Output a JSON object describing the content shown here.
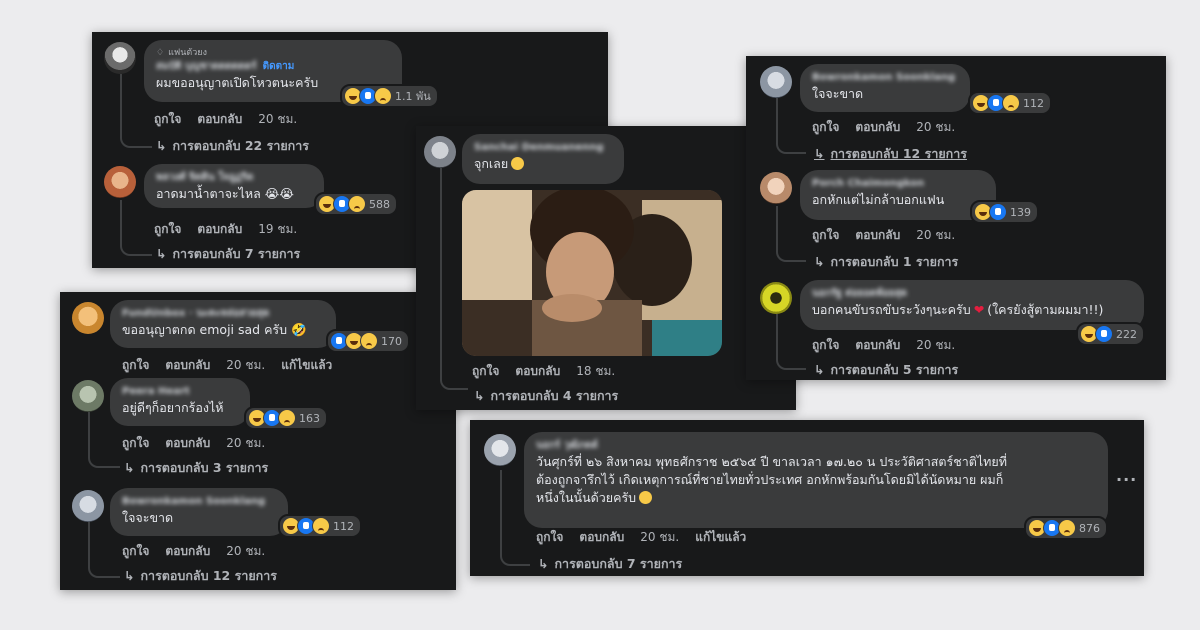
{
  "colors": {
    "page_bg": "#ececee",
    "panel_bg": "#18191a",
    "bubble_bg": "#3a3b3c",
    "link": "#4599ff",
    "heart": "#e41e3f"
  },
  "panels": [
    {
      "comments": [
        {
          "name": "สมบัติ บุญชาดดดดดดร์",
          "badge": "แฟนตัวยง",
          "follow": "ติดตาม",
          "text": "ผมขออนุญาตเปิดโหวตนะครับ",
          "reactions": [
            "haha",
            "like",
            "sad"
          ],
          "count": "1.1 พัน",
          "actions": [
            "ถูกใจ",
            "ตอบกลับ",
            "20 ชม."
          ],
          "replies": "การตอบกลับ 22 รายการ"
        },
        {
          "name": "พลวงศ์ จิดดิน ใจอูฏริด",
          "text": "อาดมาน้ำตาจะไหล 😭😭",
          "reactions": [
            "haha",
            "like",
            "sad"
          ],
          "count": "588",
          "actions": [
            "ถูกใจ",
            "ตอบกลับ",
            "19 ชม."
          ],
          "replies": "การตอบกลับ 7 รายการ"
        }
      ]
    },
    {
      "comments": [
        {
          "name": "FundUnbox · นะคะหล่อสวยสุด",
          "text": "ขออนุญาตกด emoji sad ครับ 🤣",
          "reactions": [
            "like",
            "haha",
            "sad"
          ],
          "count": "170",
          "actions": [
            "ถูกใจ",
            "ตอบกลับ",
            "20 ชม.",
            "แก้ไขแล้ว"
          ]
        },
        {
          "name": "Peera Heart",
          "text": "อยู่ดีๆก็อยากร้องไห้",
          "reactions": [
            "haha",
            "like",
            "sad"
          ],
          "count": "163",
          "actions": [
            "ถูกใจ",
            "ตอบกลับ",
            "20 ชม."
          ],
          "replies": "การตอบกลับ 3 รายการ"
        },
        {
          "name": "Bowronkamon Soonklang",
          "text": "ใจจะขาด",
          "reactions": [
            "haha",
            "like",
            "sad"
          ],
          "count": "112",
          "actions": [
            "ถูกใจ",
            "ตอบกลับ",
            "20 ชม."
          ],
          "replies": "การตอบกลับ 12 รายการ"
        }
      ]
    },
    {
      "comments": [
        {
          "name": "Sanchai Denmuanenng",
          "text": "จุกเลย",
          "actions": [
            "ถูกใจ",
            "ตอบกลับ",
            "18 ชม."
          ],
          "replies": "การตอบกลับ 4 รายการ"
        }
      ]
    },
    {
      "comments": [
        {
          "name": "Bowronkamon Soonklang",
          "text": "ใจจะขาด",
          "reactions": [
            "haha",
            "like",
            "sad"
          ],
          "count": "112",
          "actions": [
            "ถูกใจ",
            "ตอบกลับ",
            "20 ชม."
          ],
          "replies": "การตอบกลับ 12 รายการ"
        },
        {
          "name": "Porch Chaimongkon",
          "text": "อกหักแต่ไม่กล้าบอกแฟน",
          "reactions": [
            "haha",
            "like"
          ],
          "count": "139",
          "actions": [
            "ถูกใจ",
            "ตอบกลับ",
            "20 ชม."
          ],
          "replies": "การตอบกลับ 1 รายการ"
        },
        {
          "name": "นอกรัฐ ต่อยอดพ้อยสุด",
          "text": "บอกคนขับรถขับระวังๆนะครับ",
          "text2": "(ใครยังสู้ตามผมมา!!)",
          "reactions": [
            "haha",
            "like"
          ],
          "count": "222",
          "actions": [
            "ถูกใจ",
            "ตอบกลับ",
            "20 ชม."
          ],
          "replies": "การตอบกลับ 5 รายการ"
        }
      ]
    },
    {
      "comments": [
        {
          "name": "นอกร์ วุฒิภดด์",
          "line1": "วันศุกร์ที่ ๒๖ สิงหาคม พุทธศักราช ๒๕๖๕ ปี ขาลเวลา ๑๗.๒๐ น ประวัติศาสตร์ชาติไทยที่",
          "line2": "ต้องถูกจารึกไว้ เกิดเหตุการณ์ที่ชายไทยทั่วประเทศ อกหักพร้อมกันโดยมิได้นัดหมาย ผมก็",
          "line3": "หนึ่งในนั้นด้วยครับ",
          "reactions": [
            "haha",
            "like",
            "sad"
          ],
          "count": "876",
          "actions": [
            "ถูกใจ",
            "ตอบกลับ",
            "20 ชม.",
            "แก้ไขแล้ว"
          ],
          "replies": "การตอบกลับ 7 รายการ",
          "more": "···"
        }
      ]
    }
  ]
}
